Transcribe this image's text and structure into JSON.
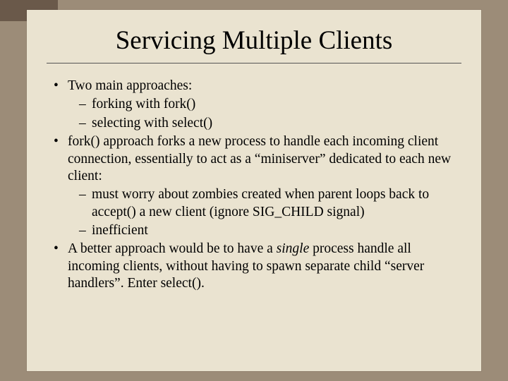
{
  "title": "Servicing Multiple Clients",
  "bullets": {
    "b0": "Two main approaches:",
    "b0a": "forking with fork()",
    "b0b": "selecting with select()",
    "b1": "fork() approach forks a new process to handle each incoming client connection, essentially to act as a “miniserver” dedicated to each new client:",
    "b1a": "must worry about zombies created when parent loops back to accept() a new client (ignore SIG_CHILD signal)",
    "b1b": "inefficient",
    "b2_pre": "A better approach would be to have a ",
    "b2_em": "single",
    "b2_post": " process handle all incoming clients, without having to spawn separate child “server handlers”. Enter select()."
  }
}
